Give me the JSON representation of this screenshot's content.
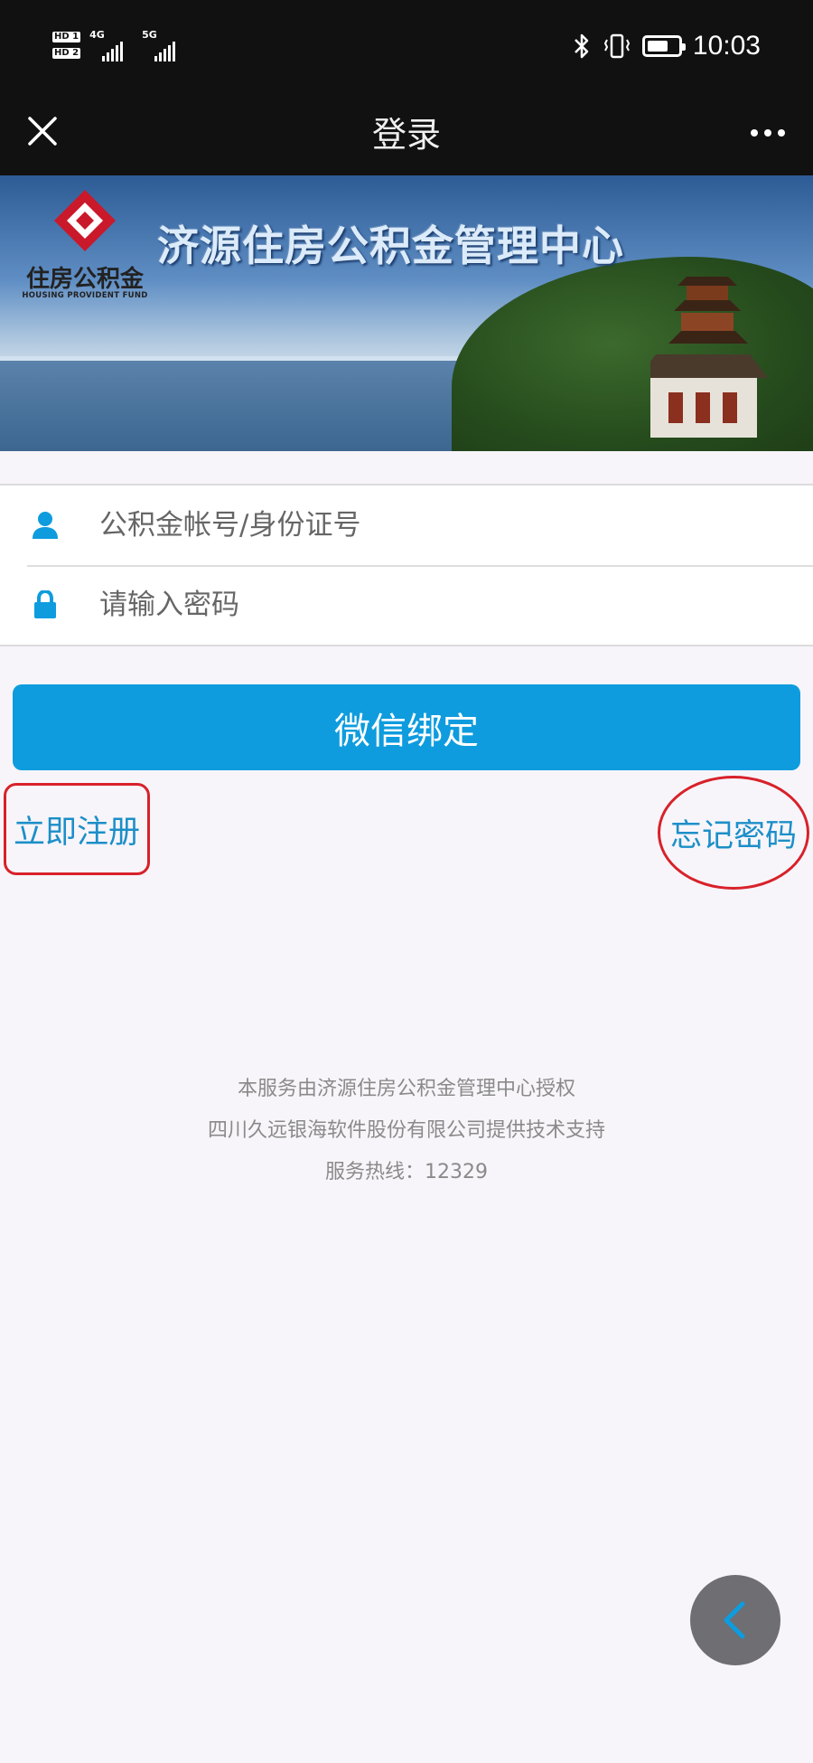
{
  "status_bar": {
    "sim1": "HD 1",
    "sim2": "HD 2",
    "net1": "4G",
    "net2": "5G",
    "time": "10:03",
    "icons": [
      "bluetooth-icon",
      "vibrate-icon",
      "battery-icon"
    ],
    "battery_level_pct": 70
  },
  "nav": {
    "title": "登录",
    "close_icon": "close-icon",
    "more_icon": "more-icon"
  },
  "banner": {
    "logo_text": "住房公积金",
    "logo_subtext": "HOUSING PROVIDENT FUND",
    "title": "济源住房公积金管理中心"
  },
  "form": {
    "account_placeholder": "公积金帐号/身份证号",
    "password_placeholder": "请输入密码",
    "account_icon": "user-icon",
    "password_icon": "lock-icon"
  },
  "actions": {
    "bind_label": "微信绑定",
    "register_label": "立即注册",
    "forgot_label": "忘记密码"
  },
  "footer": {
    "line1": "本服务由济源住房公积金管理中心授权",
    "line2": "四川久远银海软件股份有限公司提供技术支持",
    "line3": "服务热线：12329"
  },
  "colors": {
    "accent": "#0e9cde",
    "link": "#1c8fc8",
    "annotation": "#d8212a",
    "bar": "#111111"
  }
}
